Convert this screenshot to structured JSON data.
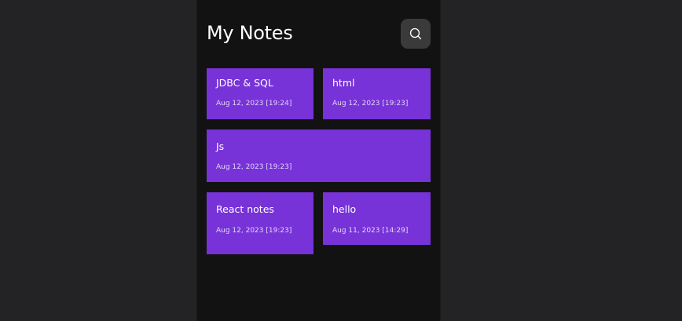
{
  "header": {
    "title": "My Notes",
    "search_icon": "search-icon"
  },
  "notes": [
    {
      "title": "JDBC & SQL",
      "date": "Aug 12, 2023 [19:24]"
    },
    {
      "title": "html",
      "date": "Aug 12, 2023 [19:23]"
    },
    {
      "title": "Js",
      "date": "Aug 12, 2023 [19:23]"
    },
    {
      "title": "React notes",
      "date": "Aug 12, 2023 [19:23]"
    },
    {
      "title": "hello",
      "date": "Aug 11, 2023 [14:29]"
    }
  ],
  "colors": {
    "page_bg": "#232325",
    "app_bg": "#121212",
    "note_bg": "#7732d8",
    "search_button_bg": "#3a3a3a"
  }
}
